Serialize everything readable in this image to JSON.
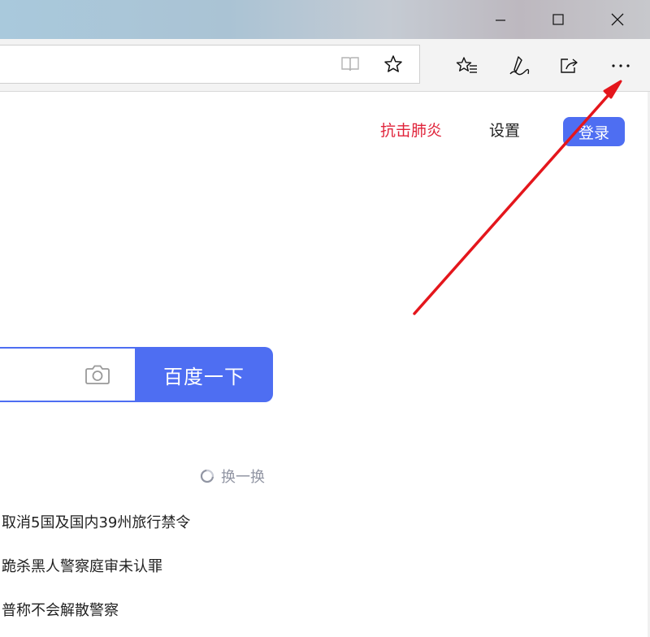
{
  "window": {
    "minimize_icon": "minimize-icon",
    "maximize_icon": "maximize-icon",
    "close_icon": "close-icon"
  },
  "toolbar": {
    "icons": [
      "reading-view-icon",
      "favorite-star-icon",
      "favorites-list-icon",
      "pen-notes-icon",
      "share-icon",
      "more-options-icon"
    ]
  },
  "header": {
    "link_red": "抗击肺炎",
    "link_settings": "设置",
    "login": "登录"
  },
  "search": {
    "button": "百度一下",
    "camera_icon": "camera-icon"
  },
  "hot": {
    "refresh": "换一换",
    "items": [
      "取消5国及国内39州旅行禁令",
      "跪杀黑人警察庭审未认罪",
      "普称不会解散警察"
    ]
  },
  "colors": {
    "accent": "#4e6ef2",
    "red_link": "#e0233a",
    "annotation_arrow": "#e4161c"
  }
}
